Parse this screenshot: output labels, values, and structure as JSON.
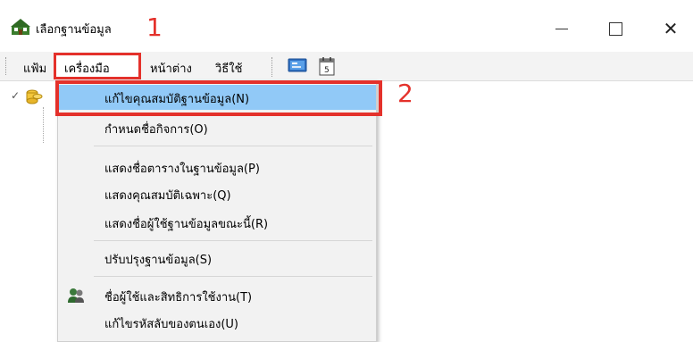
{
  "window": {
    "title": "เลือกฐานข้อมูล",
    "minimize": "—",
    "maximize": "☐",
    "close": "✕"
  },
  "annotations": {
    "step1": "1",
    "step2": "2",
    "color": "#e4312b"
  },
  "menubar": {
    "file": "แฟ้ม",
    "tools": "เครื่องมือ",
    "window": "หน้าต่าง",
    "help": "วิธีใช้"
  },
  "tools_menu": {
    "items": [
      {
        "label": "แก้ไขคุณสมบัติฐานข้อมูล(N)",
        "highlighted": true
      },
      {
        "label": "กำหนดชื่อกิจการ(O)"
      },
      {
        "label": "แสดงชื่อตารางในฐานข้อมูล(P)"
      },
      {
        "label": "แสดงคุณสมบัติเฉพาะ(Q)"
      },
      {
        "label": "แสดงชื่อผู้ใช้ฐานข้อมูลขณะนี้(R)"
      },
      {
        "label": "ปรับปรุงฐานข้อมูล(S)"
      },
      {
        "label": "ชื่อผู้ใช้และสิทธิการใช้งาน(T)",
        "icon": "users-icon"
      },
      {
        "label": "แก้ไขรหัสลับของตนเอง(U)"
      }
    ],
    "highlight_color": "#91c9f7"
  },
  "tree": {
    "expand_icon": "chevron-down-icon",
    "node_icon": "database-icon"
  }
}
